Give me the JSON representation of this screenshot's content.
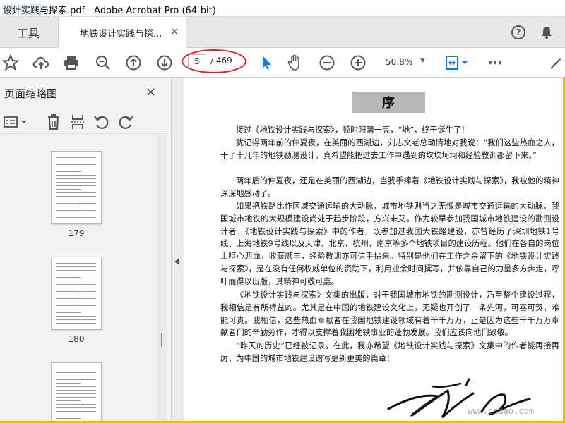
{
  "window": {
    "title": "设计实践与探索.pdf - Adobe Acrobat Pro (64-bit)",
    "watermark_logo": "道格网"
  },
  "tabs": {
    "tools_label": "工具",
    "doc_label": "地铁设计实践与探...",
    "close_glyph": "×"
  },
  "toolbar": {
    "current_page": "5",
    "total_pages": "/ 469",
    "zoom": "50.8%",
    "zoom_caret": "▼"
  },
  "left_panel": {
    "title": "页面缩略图",
    "close_glyph": "×",
    "thumbnails": [
      {
        "label": "179"
      },
      {
        "label": "180"
      },
      {
        "label": ""
      }
    ]
  },
  "document": {
    "heading": "序",
    "paragraphs": [
      "接过《地铁设计实践与探索》，顿时眼睛一亮，“地”，终于诞生了！",
      "犹记得两年前的仲夏夜，在美丽的西湖边，刘志文老总动情地对我说：“我们这些热血之人，干了十几年的地铁勘测设计，真希望能把过去工作中遇到的坎坎坷坷和经验教训都留下来。”",
      "两年后的仲夏夜，还是在美丽的西湖边，当我手捧着《地铁设计实践与探索》，我被他的精神深深地感动了。",
      "如果把铁路比作区域交通运输的大动脉，城市地铁则当之无愧是城市交通运输的大动脉。我国城市地铁的大规模建设尚处于起步阶段，方兴未艾。作为较早参加我国城市地铁建设的勘测设计者，《地铁设计实践与探索》中的作者，既参加过我国大铁路建设，亦曾经历了深圳地铁1号线、上海地铁9号线以及天津、北京、杭州、南京等多个地铁项目的建设历程。他们在各自的岗位上呕心沥血，收获颇丰，经验教训亦可信手拈来。特别是他们在工作之余留下的《地铁设计实践与探索》，是在没有任何权威单位的资助下，利用业余时间撰写，并依靠自己的力量多方奔走，呼吁而得以出版，其精神可敬可嘉。",
      "《地铁设计实践与探索》文集的出版，对于我国城市地铁的勘测设计，乃至整个建设过程，我相信是有所裨益的。尤其是在中国的地铁建设文化上，无疑也开创了一条先河，可喜可贺，难能可贵。我相信，这些热血奉献者在我国地铁建设领域有着千千万万，正是因为这些千千万万奉献者们的辛勤劳作，才得以支撑着我国地铁事业的蓬勃发展。我们应该向他们致敬。",
      "“昨天的历史”已经被记录。在此，我亦希望《地铁设计实践与探索》文集中的作者能再接再厉，为中国的城市地铁建设谱写更新更美的篇章！"
    ]
  },
  "watermark_bottom": "www.cndao.com",
  "colors": {
    "highlight_ellipse": "#e02020",
    "frame": "#f0c000",
    "accent_blue": "#1a73e8"
  }
}
